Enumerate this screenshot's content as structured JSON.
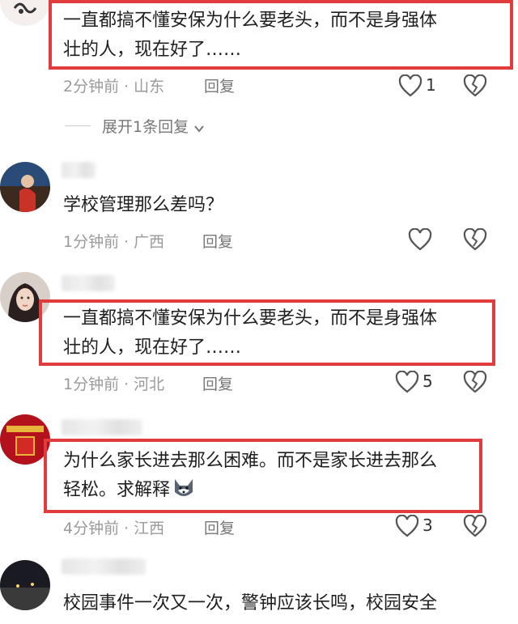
{
  "comments": [
    {
      "text_lines": [
        "一直都搞不懂安保为什么要老头，而不是身强体",
        "壮的人，现在好了……"
      ],
      "time": "2分钟前",
      "sep": "·",
      "location": "山东",
      "reply_label": "回复",
      "likes": "1",
      "expand_label": "展开1条回复"
    },
    {
      "text_lines": [
        "学校管理那么差吗？"
      ],
      "time": "1分钟前",
      "sep": "·",
      "location": "广西",
      "reply_label": "回复",
      "likes": ""
    },
    {
      "text_lines": [
        "一直都搞不懂安保为什么要老头，而不是身强体",
        "壮的人，现在好了……"
      ],
      "time": "1分钟前",
      "sep": "·",
      "location": "河北",
      "reply_label": "回复",
      "likes": "5"
    },
    {
      "text_lines": [
        "为什么家长进去那么困难。而不是家长进去那么",
        "轻松。求解释"
      ],
      "time": "4分钟前",
      "sep": "·",
      "location": "江西",
      "reply_label": "回复",
      "likes": "3"
    },
    {
      "text_lines": [
        "校园事件一次又一次，警钟应该长鸣，校园安全"
      ]
    }
  ],
  "colors": {
    "highlight_border": "#e23b3b",
    "meta_text": "#9a9a9a"
  },
  "icons": [
    "heart-outline-icon",
    "broken-heart-icon",
    "chevron-down-icon",
    "husky-emoji-icon"
  ]
}
